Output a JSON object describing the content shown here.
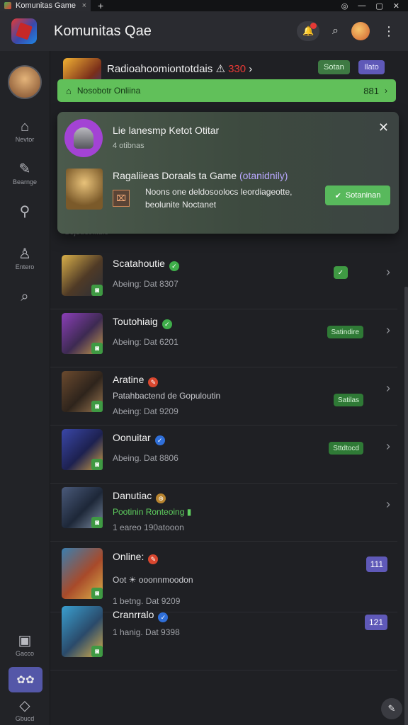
{
  "window": {
    "tab_title": "Komunitas Game",
    "tab_close": "×",
    "new_tab": "+",
    "controls": [
      "◎",
      "—",
      "▢",
      "✕"
    ]
  },
  "header": {
    "title": "Komunitas Qae",
    "icons": [
      "bell-icon",
      "search-icon",
      "avatar",
      "more-icon"
    ]
  },
  "sidebar": {
    "items": [
      {
        "icon": "⌂",
        "label": "Nevtor"
      },
      {
        "icon": "✎",
        "label": "Bearnge"
      },
      {
        "icon": "⚲",
        "label": ""
      },
      {
        "icon": "♙",
        "label": "Entero"
      },
      {
        "icon": "⌕",
        "label": ""
      },
      {
        "icon": "▣",
        "label": "Gacco"
      },
      {
        "icon": "◇",
        "label": "Gbucd"
      }
    ],
    "active_icon": "✿✿"
  },
  "featured": {
    "title_main": "Radioahoomiontotdais",
    "title_sep": " ⚠ ",
    "title_red": "330",
    "title_tail": " ›",
    "chip_green": "Sotan",
    "chip_purple": "Ilato",
    "bar_icon": "⌂",
    "bar_text": "Nosobotr Onliina",
    "bar_count": "881",
    "bar_chevron": "›"
  },
  "popup": {
    "title": "Lie lanesmp Ketot Otitar",
    "subtitle": "4 otibnas",
    "close": "✕",
    "question_main": "Ragaliieas Doraals ta Game",
    "question_highlight": "(otanidnily)",
    "box_icon": "⌧",
    "desc_line1": "Noons one deldosoolocs leordiageotte,",
    "desc_line2": "beolunite Noctanet",
    "button_check": "✔",
    "button_label": "Sotaninan"
  },
  "under_text": "Sojouot    lllulo",
  "colors": {
    "accent_green": "#61c05a",
    "accent_purple": "#5f59b8",
    "background": "#1f2024"
  },
  "rows": [
    {
      "name": "Scatahoutie",
      "emblem": "✓",
      "emblem_color": "#3fae4a",
      "line2": "",
      "line3": "Abeing: Dat 8307",
      "badge": "◙",
      "right_chip": "✓",
      "right_chip_kind": "check",
      "chevron": "›"
    },
    {
      "name": "Toutohiaig",
      "emblem": "✓",
      "emblem_color": "#3fae4a",
      "line2": "",
      "line3": "Abeing: Dat 6201",
      "badge": "◙",
      "right_chip": "Satindire",
      "right_chip_kind": "green",
      "chevron": "›"
    },
    {
      "name": "Aratine",
      "emblem": "✎",
      "emblem_color": "#d9472f",
      "line2": "Patahbactend de Gopuloutin",
      "line3": "Abeing: Dat 9209",
      "badge": "◙",
      "right_chip": "Satilas",
      "right_chip_kind": "green",
      "chevron": "›"
    },
    {
      "name": "Oonuitar",
      "emblem": "✓",
      "emblem_color": "#2f6fd9",
      "line2": "",
      "line3": "Abeing. Dat 8806",
      "badge": "◙",
      "right_chip": "Sttdtocd",
      "right_chip_kind": "green",
      "chevron": "›"
    },
    {
      "name": "Danutiac",
      "emblem": "⊕",
      "emblem_color": "#b8842f",
      "line2": "Pootinin Ronteoing ▮",
      "line3": "1 eareo 190atooon",
      "badge": "◙",
      "right_chip": "",
      "right_chip_kind": "none",
      "chevron": "›"
    },
    {
      "name": "Online:",
      "emblem": "✎",
      "emblem_color": "#d9472f",
      "line2": "Oot ☀ ooonnmoodon",
      "line3": "1 betng. Dat 9209",
      "badge": "◙",
      "right_chip": "111",
      "right_chip_kind": "purple",
      "chevron": ""
    },
    {
      "name": "Cranrralo",
      "emblem": "✓",
      "emblem_color": "#2f6fd9",
      "line2": "",
      "line3": "1 hanig. Dat 9398",
      "badge": "◙",
      "right_chip": "121",
      "right_chip_kind": "purple",
      "chevron": ""
    }
  ],
  "fab_icon": "✎"
}
